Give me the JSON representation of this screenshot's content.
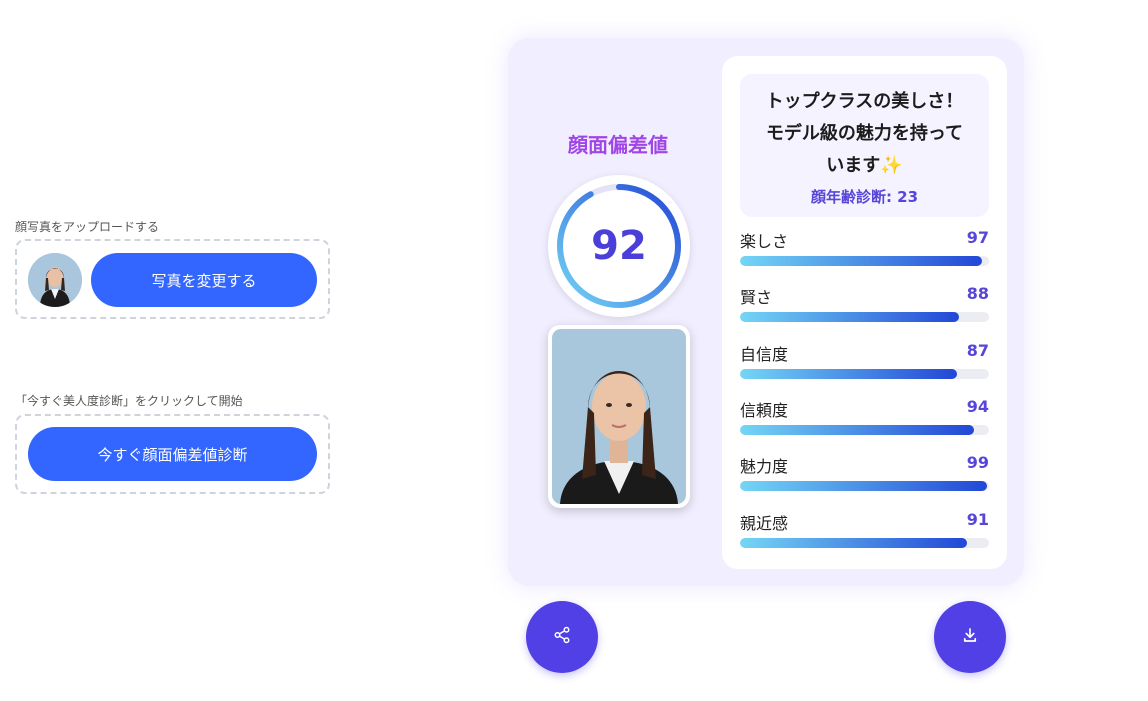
{
  "upload": {
    "label": "顔写真をアップロードする",
    "change_button": "写真を変更する"
  },
  "start": {
    "label": "「今すぐ美人度診断」をクリックして開始",
    "button": "今すぐ顔面偏差値診断"
  },
  "result": {
    "score_title": "顔面偏差値",
    "score": 92,
    "headline_line1": "トップクラスの美しさ！",
    "headline_line2": "モデル級の魅力を持って",
    "headline_line3": "います✨",
    "age_label": "顔年齢診断: 23",
    "traits": [
      {
        "name": "楽しさ",
        "value": 97
      },
      {
        "name": "賢さ",
        "value": 88
      },
      {
        "name": "自信度",
        "value": 87
      },
      {
        "name": "信頼度",
        "value": 94
      },
      {
        "name": "魅力度",
        "value": 99
      },
      {
        "name": "親近感",
        "value": 91
      }
    ]
  },
  "actions": {
    "share_icon": "share-icon",
    "download_icon": "download-icon"
  },
  "colors": {
    "primary": "#3366ff",
    "accent": "#5040e6",
    "title": "#a146e6"
  }
}
